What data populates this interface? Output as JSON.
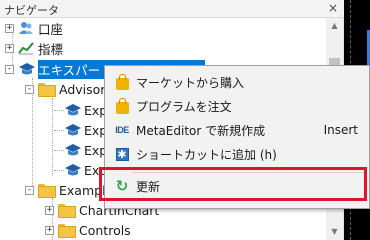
{
  "navigator": {
    "title": "ナビゲータ",
    "close_glyph": "×",
    "items": [
      {
        "label": "口座",
        "expander": "+"
      },
      {
        "label": "指標",
        "expander": "+"
      },
      {
        "label": "エキスパートアドバイザ(EA)",
        "expander": "-"
      },
      {
        "label": "Advisors",
        "expander": "-"
      },
      {
        "label": "Expe"
      },
      {
        "label": "Expe"
      },
      {
        "label": "Expe"
      },
      {
        "label": "Exp"
      },
      {
        "label": "Exampl",
        "expander": "-"
      },
      {
        "label": "ChartInChart",
        "expander": "+"
      },
      {
        "label": "Controls",
        "expander": "+"
      }
    ]
  },
  "context_menu": {
    "items": [
      {
        "label": "マーケットから購入",
        "icon": "shopping-bag-icon"
      },
      {
        "label": "プログラムを注文",
        "icon": "shopping-bag-icon"
      },
      {
        "label": "MetaEditor で新規作成",
        "icon": "ide-icon",
        "icon_text": "IDE",
        "shortcut": "Insert"
      },
      {
        "label": "ショートカットに追加 (h)",
        "icon": "shortcut-icon",
        "icon_text": "✱"
      },
      {
        "label": "更新",
        "icon": "refresh-icon",
        "icon_text": "↻"
      }
    ]
  },
  "colors": {
    "selection": "#0078d7",
    "highlight_border": "#e0142a",
    "folder": "#f5c542",
    "refresh": "#2fa84f"
  }
}
